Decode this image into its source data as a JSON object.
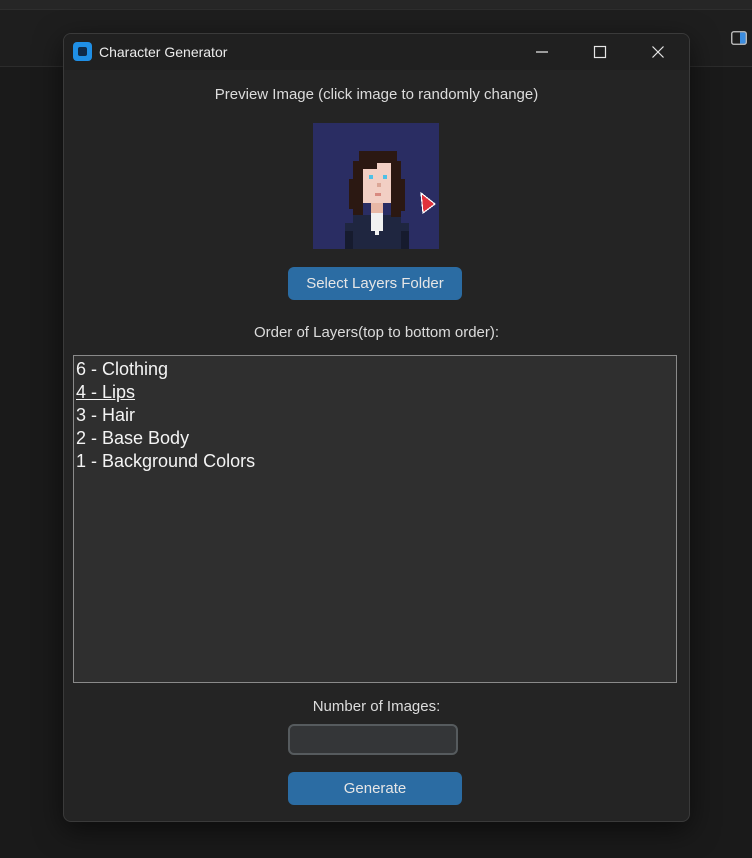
{
  "window": {
    "title": "Character Generator"
  },
  "preview": {
    "label": "Preview Image (click image to randomly change)"
  },
  "buttons": {
    "select_layers": "Select Layers Folder",
    "generate": "Generate"
  },
  "layers": {
    "label": "Order of Layers(top to bottom order):",
    "items": [
      "6 - Clothing",
      "4 - Lips",
      "3 - Hair",
      "2 - Base Body",
      "1 - Background Colors"
    ],
    "active_index": 1
  },
  "count": {
    "label": "Number of Images:",
    "value": ""
  },
  "icons": {
    "app": "app-icon",
    "minimize": "minimize-icon",
    "maximize": "maximize-icon",
    "close": "close-icon",
    "background": "sidebar-toggle-icon"
  },
  "colors": {
    "accent_button": "#2b6ca3",
    "app_icon": "#1f8fe6",
    "window_bg": "#242424",
    "listbox_bg": "#2f2f2f",
    "preview_bg": "#2a2d63",
    "cursor": "#e0313c"
  }
}
